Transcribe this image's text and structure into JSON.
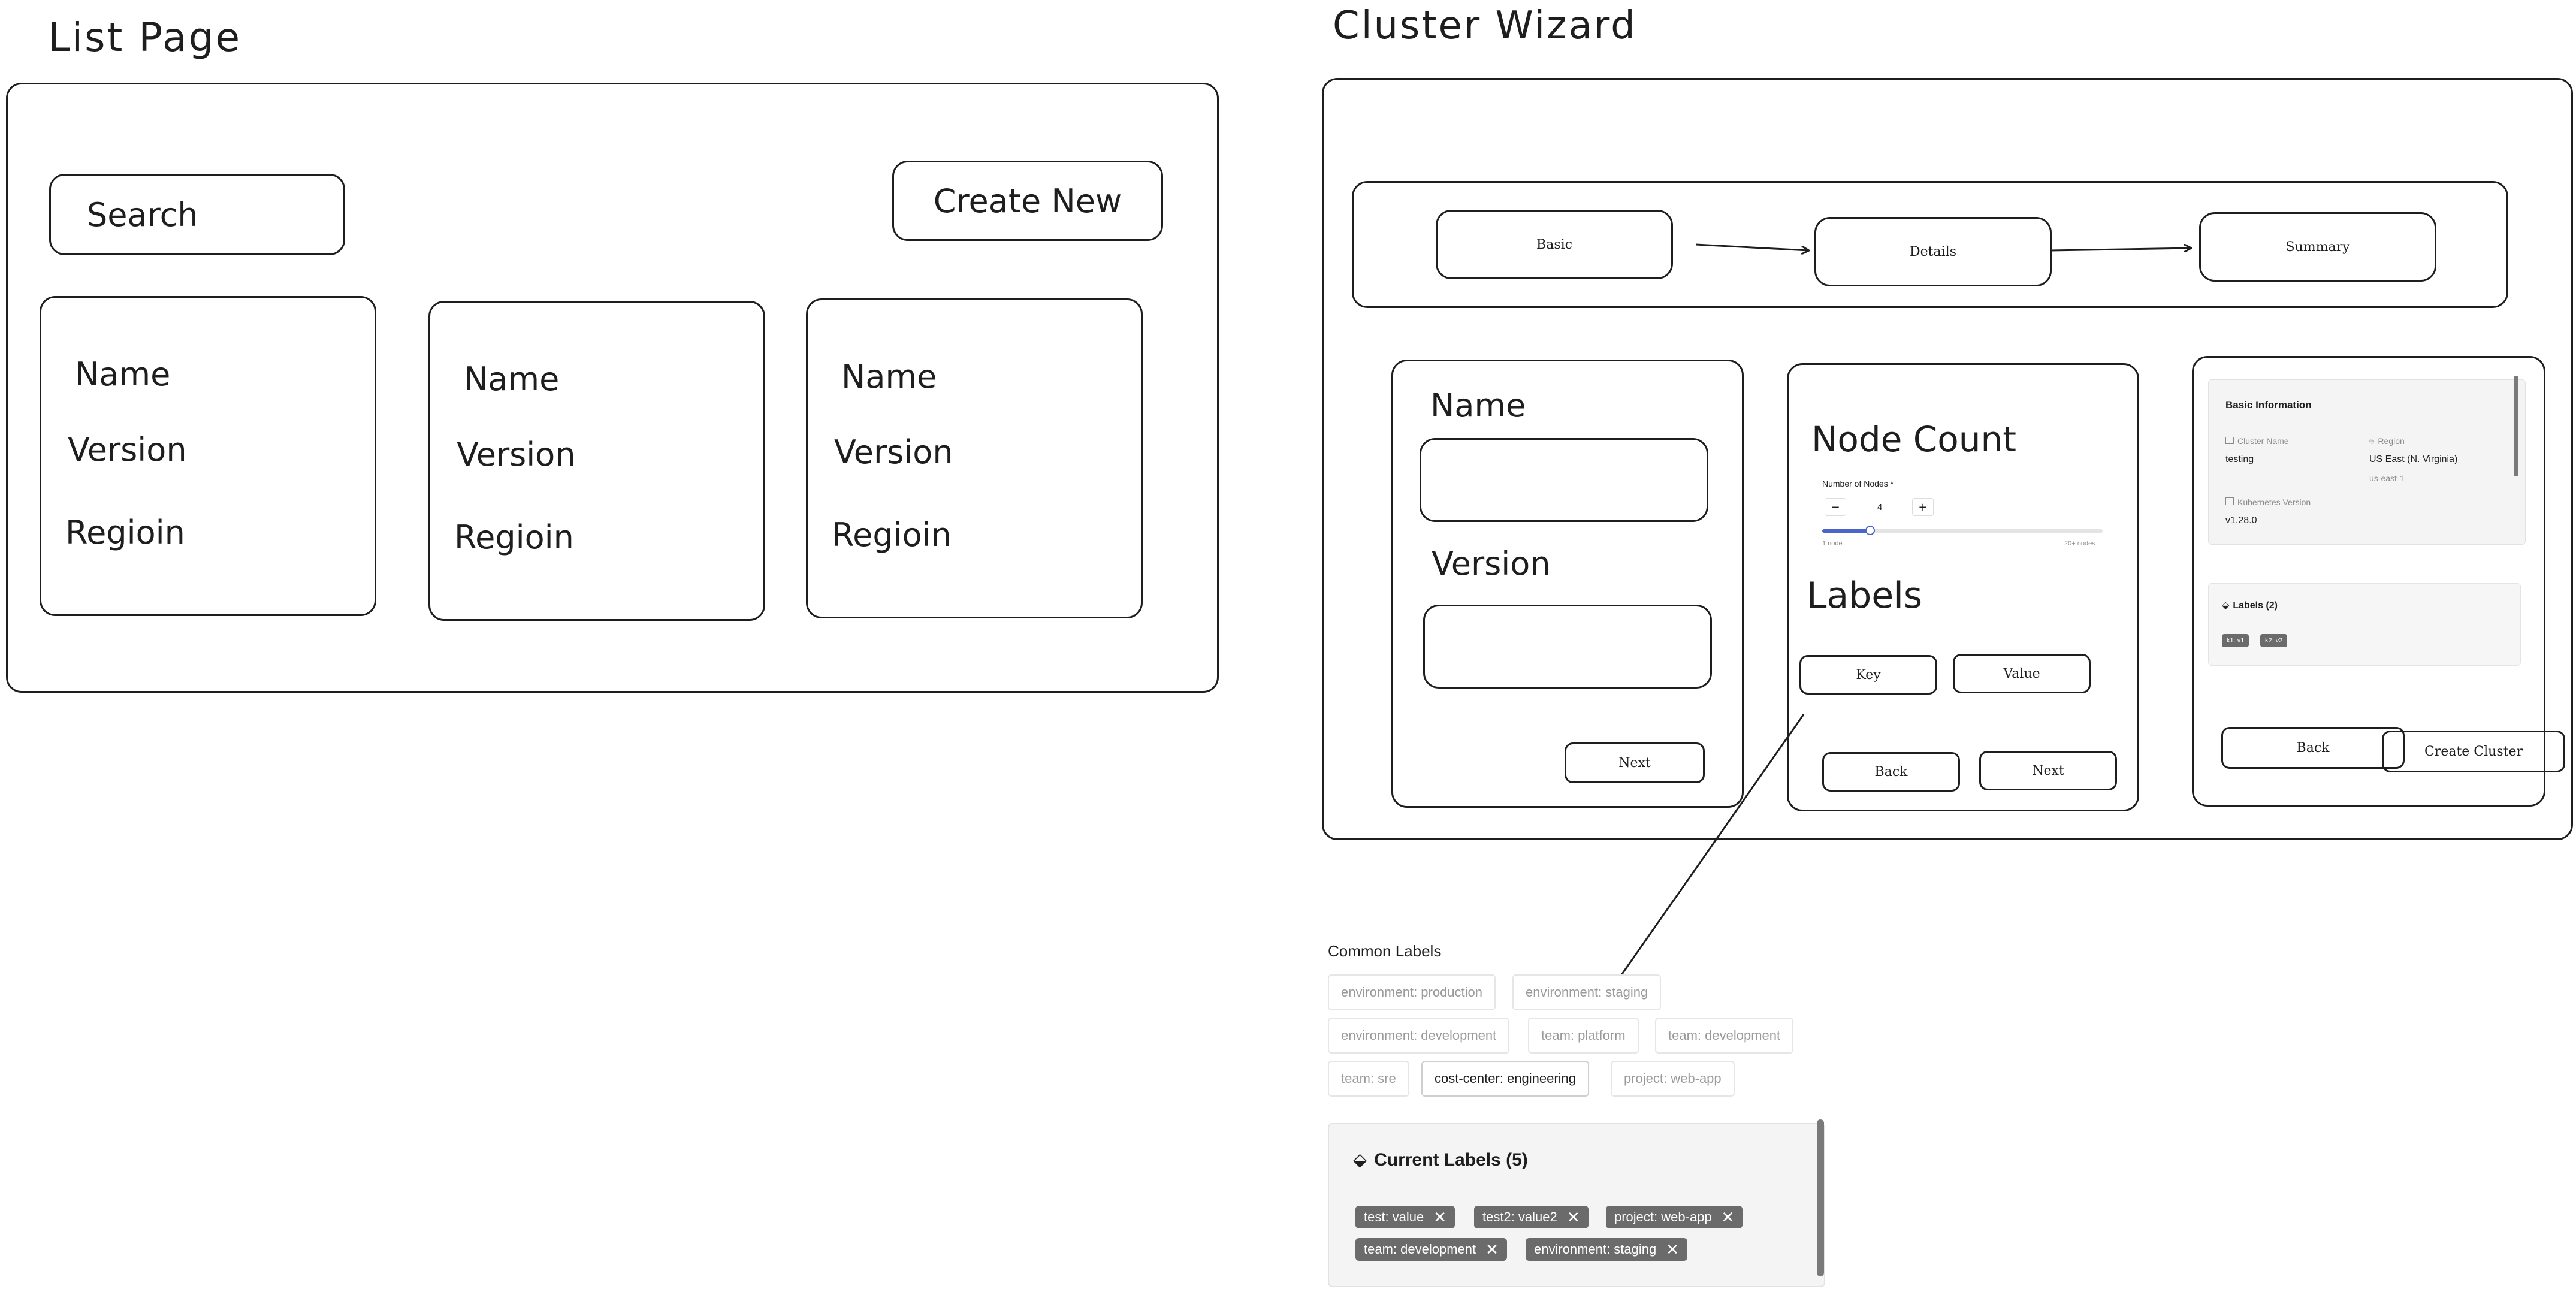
{
  "list_page": {
    "title": "List Page",
    "search_label": "Search",
    "create_label": "Create New",
    "cards": [
      {
        "name": "Name",
        "version": "Version",
        "region": "Regioin"
      },
      {
        "name": "Name",
        "version": "Version",
        "region": "Regioin"
      },
      {
        "name": "Name",
        "version": "Version",
        "region": "Regioin"
      }
    ]
  },
  "wizard": {
    "title": "Cluster Wizard",
    "steps": [
      "Basic",
      "Details",
      "Summary"
    ],
    "basic": {
      "name_label": "Name",
      "version_label": "Version",
      "next_label": "Next"
    },
    "details": {
      "node_count_title": "Node Count",
      "nodes_label": "Number of Nodes *",
      "minus": "−",
      "plus": "+",
      "nodes_value": "4",
      "slider_value": 0.17,
      "min_label": "1 node",
      "max_label": "20+ nodes",
      "labels_title": "Labels",
      "key_label": "Key",
      "value_label": "Value",
      "back_label": "Back",
      "next_label": "Next"
    },
    "summary": {
      "basic_info_title": "Basic Information",
      "cluster_name_label": "Cluster Name",
      "cluster_name_value": "testing",
      "region_label": "Region",
      "region_value": "US East (N. Virginia)",
      "region_code": "us-east-1",
      "k8s_label": "Kubernetes Version",
      "k8s_value": "v1.28.0",
      "labels_title": "Labels (2)",
      "tags": [
        "k1: v1",
        "k2: v2"
      ],
      "back_label": "Back",
      "create_label": "Create Cluster"
    }
  },
  "common_labels": {
    "title": "Common Labels",
    "options": [
      "environment: production",
      "environment: staging",
      "environment: development",
      "team: platform",
      "team: development",
      "team: sre",
      "cost-center: engineering",
      "project: web-app"
    ],
    "selected": "cost-center: engineering"
  },
  "current_labels": {
    "title": "Current Labels (5)",
    "tags": [
      "test: value",
      "test2: value2",
      "project: web-app",
      "team: development",
      "environment: staging"
    ],
    "remove_glyph": "✕"
  }
}
